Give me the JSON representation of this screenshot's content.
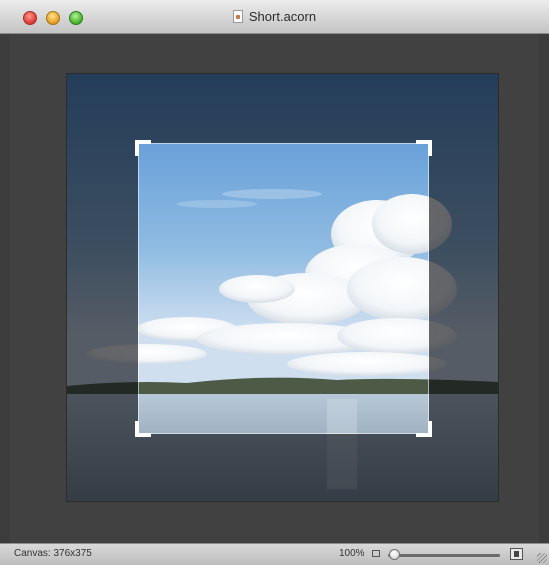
{
  "window": {
    "title": "Short.acorn"
  },
  "traffic_lights": {
    "close_icon": "close-icon",
    "minimize_icon": "minimize-icon",
    "zoom_icon": "zoom-icon"
  },
  "document": {
    "icon": "acorn-document-icon",
    "crop_tool_active": true
  },
  "statusbar": {
    "canvas_size": "Canvas: 376x375",
    "zoom_percent": "100%",
    "zoom_level": 0.05
  },
  "colors": {
    "workspace": "#414141",
    "crop_handles": "#ffffff",
    "dim_overlay": "rgba(10,12,16,0.62)"
  }
}
